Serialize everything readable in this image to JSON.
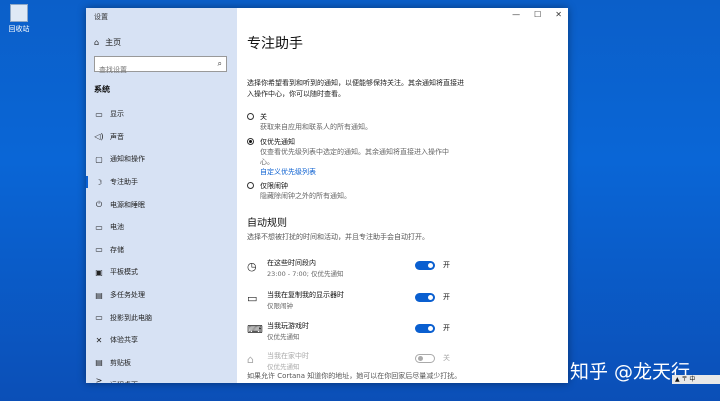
{
  "desktop": {
    "recycle_label": "回收站",
    "watermark": "知乎 @龙天行",
    "tray": "▲ 〒 中"
  },
  "window": {
    "title": "设置",
    "controls": [
      "—",
      "☐",
      "✕"
    ]
  },
  "sidebar": {
    "home": "主页",
    "search_placeholder": "查找设置",
    "category": "系统",
    "items": [
      {
        "icon": "▭",
        "label": "显示"
      },
      {
        "icon": "◁)",
        "label": "声音"
      },
      {
        "icon": "▢",
        "label": "通知和操作"
      },
      {
        "icon": "☽",
        "label": "专注助手"
      },
      {
        "icon": "⏻",
        "label": "电源和睡眠"
      },
      {
        "icon": "▭",
        "label": "电池"
      },
      {
        "icon": "▭",
        "label": "存储"
      },
      {
        "icon": "▣",
        "label": "平板模式"
      },
      {
        "icon": "▤",
        "label": "多任务处理"
      },
      {
        "icon": "▭",
        "label": "投影到此电脑"
      },
      {
        "icon": "✕",
        "label": "体验共享"
      },
      {
        "icon": "▤",
        "label": "剪贴板"
      },
      {
        "icon": "><",
        "label": "远程桌面"
      }
    ]
  },
  "main": {
    "title": "专注助手",
    "description": "选择你希望看到和听到的通知，以便能够保持关注。其余通知将直接进入操作中心，你可以随时查看。",
    "radios": [
      {
        "title": "关",
        "sub": "获取来自应用和联系人的所有通知。",
        "link": "",
        "selected": false
      },
      {
        "title": "仅优先通知",
        "sub": "仅查看优先级列表中选定的通知。其余通知将直接进入操作中心。",
        "link": "自定义优先级列表",
        "selected": true
      },
      {
        "title": "仅限闹钟",
        "sub": "隐藏除闹钟之外的所有通知。",
        "link": "",
        "selected": false
      }
    ],
    "auto_title": "自动规则",
    "auto_desc": "选择不想被打扰的时间和活动，并且专注助手会自动打开。",
    "rules": [
      {
        "icon": "◷",
        "title": "在这些时间段内",
        "sub": "23:00 - 7:00; 仅优先通知",
        "state": "开",
        "on": true
      },
      {
        "icon": "▭",
        "title": "当我在复制我的显示器时",
        "sub": "仅限闹钟",
        "state": "开",
        "on": true
      },
      {
        "icon": "⌨",
        "title": "当我玩游戏时",
        "sub": "仅优先通知",
        "state": "开",
        "on": true
      },
      {
        "icon": "⌂",
        "title": "当我在家中时",
        "sub": "仅优先通知",
        "state": "关",
        "on": false
      }
    ],
    "footer": "如果允许 Cortana 知道你的地址，她可以在你回家后尽量减少打扰。"
  }
}
